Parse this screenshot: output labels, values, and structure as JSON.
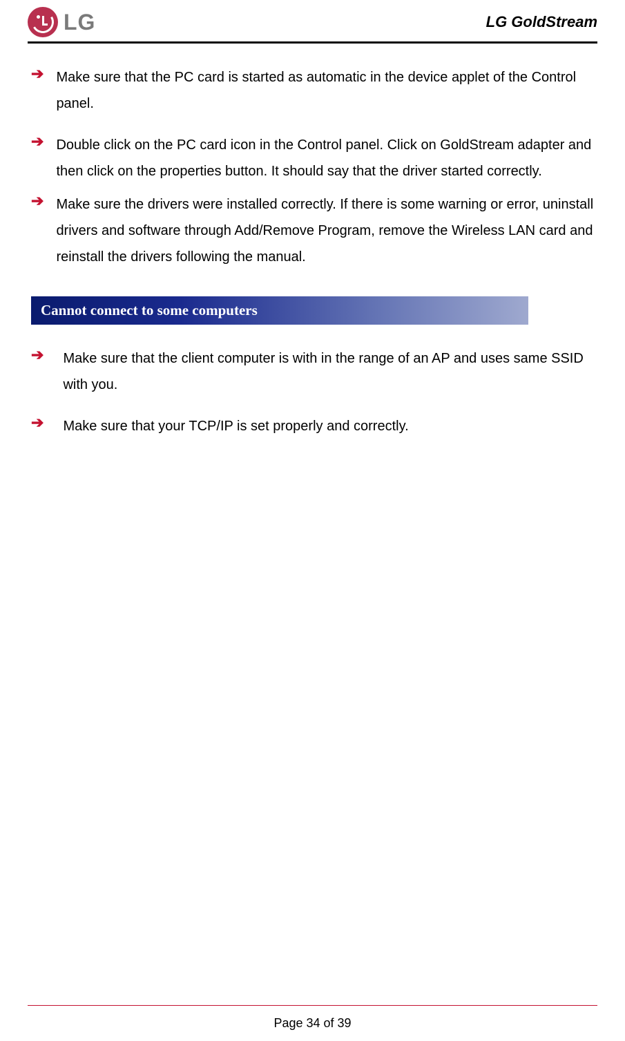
{
  "header": {
    "logo_text": "LG",
    "title": "LG GoldStream"
  },
  "content": {
    "bullets_top": [
      "Make sure that the PC card is started as automatic in the device applet of the Control panel.",
      "Double click on the PC card icon in the Control panel. Click on GoldStream adapter and then click on the properties button. It should say that the driver started correctly.",
      "Make sure the drivers were installed correctly. If there is some warning or error, uninstall drivers and software through Add/Remove Program, remove the Wireless LAN card and reinstall the drivers following the manual."
    ],
    "section_heading": "Cannot connect to some computers",
    "bullets_bottom": [
      "Make sure that the client computer is with in the range of an AP and uses same SSID with you.",
      " Make sure that your TCP/IP is set properly and correctly."
    ]
  },
  "footer": {
    "page_text": "Page 34 of 39"
  }
}
